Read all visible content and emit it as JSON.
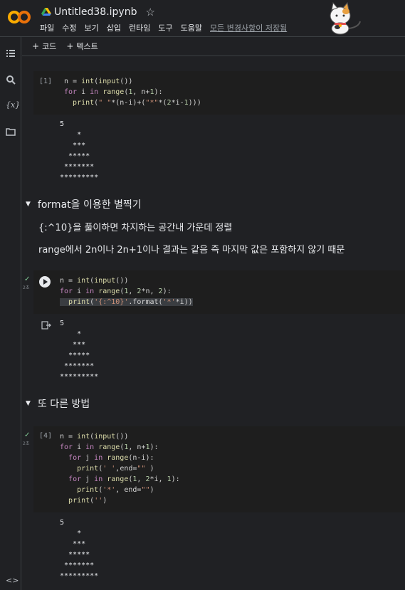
{
  "header": {
    "doc_title": "Untitled38.ipynb",
    "menu": [
      "파일",
      "수정",
      "보기",
      "삽입",
      "런타임",
      "도구",
      "도움말"
    ],
    "save_status": "모든 변경사항이 저장됨"
  },
  "toolbar": {
    "add_code": "코드",
    "add_text": "텍스트"
  },
  "cells": {
    "c1": {
      "exec_count": "[1]",
      "output": "5\n    *\n   ***\n  *****\n *******\n*********"
    },
    "h1": {
      "heading": "format을 이용한 별찍기",
      "p1": "{:^10}을 풀이하면 차지하는 공간내 가운데 정렬",
      "p2": "range에서 2n이나 2n+1이나 결과는 같음 즉 마지막 값은 포함하지 않기 때문"
    },
    "c2": {
      "check": "✓",
      "duration": "2초",
      "output": "5\n    *\n   ***\n  *****\n *******\n*********"
    },
    "h2": {
      "heading": "또 다른 방법"
    },
    "c3": {
      "exec_count": "[4]",
      "check": "✓",
      "duration": "2초",
      "output": "5\n    *\n   ***\n  *****\n *******\n*********"
    }
  },
  "icons": [
    "table-of-contents-icon",
    "search-icon",
    "variables-icon",
    "files-icon",
    "code-snippets-icon",
    "star-icon",
    "drive-icon",
    "output-icon"
  ],
  "colors": {
    "background": "#202124",
    "code_background": "#1e1e1e",
    "keyword": "#c586c0",
    "function": "#dcdcaa",
    "number": "#b5cea8",
    "string": "#ce9178",
    "success": "#81c995"
  }
}
